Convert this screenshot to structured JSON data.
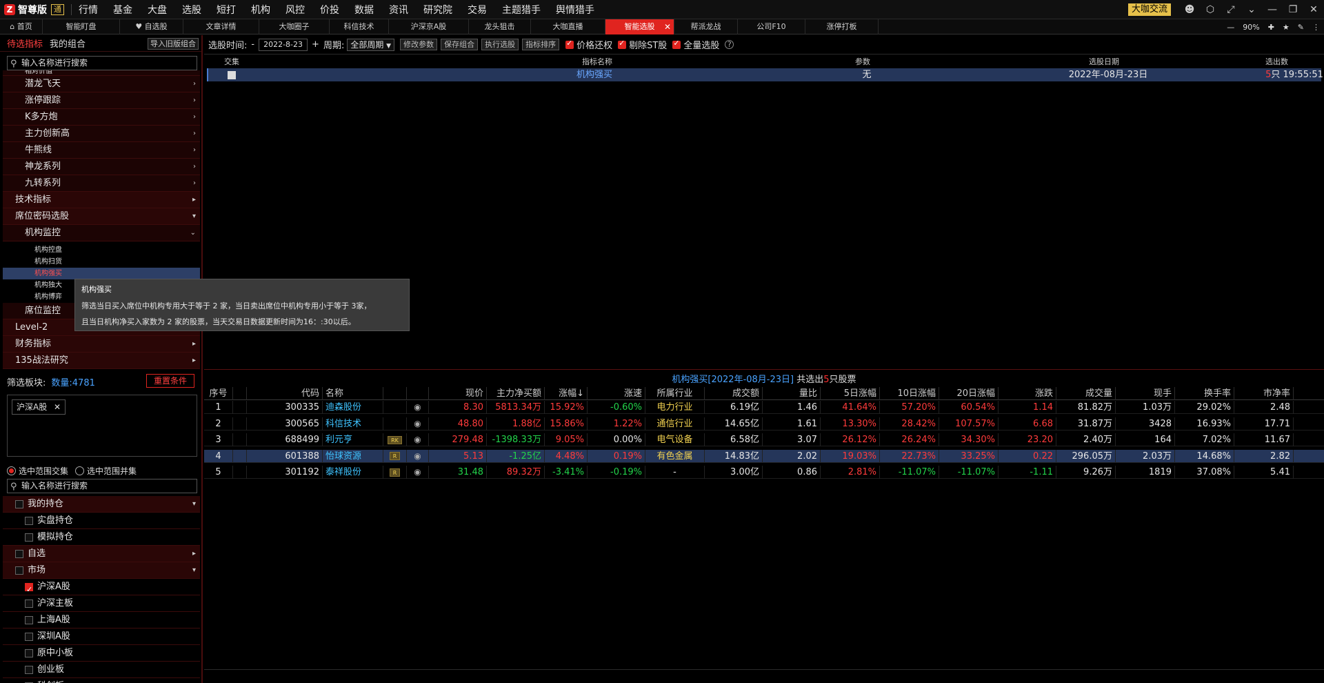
{
  "topbar": {
    "logo_mark": "Z",
    "brand": "智尊版",
    "edition_badge": "通",
    "menu": [
      {
        "label": "行情",
        "dot": false
      },
      {
        "label": "基金",
        "dot": false
      },
      {
        "label": "大盘",
        "dot": false
      },
      {
        "label": "选股",
        "dot": true
      },
      {
        "label": "短打",
        "dot": false
      },
      {
        "label": "机构",
        "dot": true
      },
      {
        "label": "风控",
        "dot": false
      },
      {
        "label": "价投",
        "dot": false
      },
      {
        "label": "数据",
        "dot": false
      },
      {
        "label": "资讯",
        "dot": false
      },
      {
        "label": "研究院",
        "dot": false
      },
      {
        "label": "交易",
        "dot": false
      },
      {
        "label": "主题猎手",
        "dot": false
      },
      {
        "label": "舆情猎手",
        "dot": true
      }
    ],
    "right_button": "大咖交流",
    "icons": [
      "user-icon",
      "settings-hex-icon",
      "collapse-icon",
      "chevron-down-icon",
      "minimize-icon",
      "restore-icon",
      "close-icon"
    ]
  },
  "tabs": {
    "items": [
      {
        "label": "首页",
        "icon": "home-icon",
        "active": false
      },
      {
        "label": "智能盯盘",
        "active": false
      },
      {
        "label": "自选股",
        "icon": "heart-icon",
        "active": false
      },
      {
        "label": "文章详情",
        "active": false
      },
      {
        "label": "大咖圈子",
        "active": false
      },
      {
        "label": "科信技术",
        "active": false
      },
      {
        "label": "沪深京A股",
        "active": false
      },
      {
        "label": "龙头狙击",
        "active": false
      },
      {
        "label": "大咖直播",
        "active": false
      },
      {
        "label": "智能选股",
        "active": true
      },
      {
        "label": "帮派龙战",
        "active": false
      },
      {
        "label": "公司F10",
        "active": false
      },
      {
        "label": "涨停打板",
        "active": false
      }
    ],
    "zoom": "90%"
  },
  "left": {
    "tabs": [
      "待选指标",
      "我的组合"
    ],
    "import_button": "导入旧版组合",
    "search_placeholder": "输入名称进行搜索",
    "partial_top": "相对价值",
    "tree": [
      {
        "label": "潜龙飞天",
        "level": 2,
        "arrow": "›"
      },
      {
        "label": "涨停跟踪",
        "level": 2,
        "arrow": "›"
      },
      {
        "label": "K多方炮",
        "level": 2,
        "arrow": "›"
      },
      {
        "label": "主力创新高",
        "level": 2,
        "arrow": "›"
      },
      {
        "label": "牛熊线",
        "level": 2,
        "arrow": "›"
      },
      {
        "label": "神龙系列",
        "level": 2,
        "arrow": "›"
      },
      {
        "label": "九转系列",
        "level": 2,
        "arrow": "›"
      },
      {
        "label": "技术指标",
        "level": 1,
        "arrow": "▸"
      },
      {
        "label": "席位密码选股",
        "level": 1,
        "arrow": "▾"
      },
      {
        "label": "机构监控",
        "level": 2,
        "arrow": "⌄"
      }
    ],
    "leaves": [
      "机构控盘",
      "机构扫货",
      "机构强买",
      "机构独大",
      "机构博弈"
    ],
    "selected_leaf": 2,
    "tree_after": [
      {
        "label": "席位监控",
        "level": 2,
        "arrow": ""
      },
      {
        "label": "Level-2",
        "level": 1,
        "arrow": ""
      },
      {
        "label": "财务指标",
        "level": 1,
        "arrow": "▸"
      },
      {
        "label": "135战法研究",
        "level": 1,
        "arrow": "▸"
      }
    ],
    "filter_label": "筛选板块:",
    "filter_count": "数量:4781",
    "reset_button": "重置条件",
    "chip": "沪深A股",
    "radio_intersect": "选中范围交集",
    "radio_union": "选中范围并集",
    "search2_placeholder": "输入名称进行搜索",
    "market_tree": [
      {
        "label": "我的持仓",
        "level": 1,
        "checked": false,
        "arrow": "▾"
      },
      {
        "label": "实盘持仓",
        "level": 2,
        "checked": false,
        "arrow": ""
      },
      {
        "label": "模拟持仓",
        "level": 2,
        "checked": false,
        "arrow": ""
      },
      {
        "label": "自选",
        "level": 1,
        "checked": false,
        "arrow": "▸"
      },
      {
        "label": "市场",
        "level": 1,
        "checked": false,
        "arrow": "▾"
      },
      {
        "label": "沪深A股",
        "level": 2,
        "checked": true,
        "arrow": ""
      },
      {
        "label": "沪深主板",
        "level": 2,
        "checked": false,
        "arrow": ""
      },
      {
        "label": "上海A股",
        "level": 2,
        "checked": false,
        "arrow": ""
      },
      {
        "label": "深圳A股",
        "level": 2,
        "checked": false,
        "arrow": ""
      },
      {
        "label": "原中小板",
        "level": 2,
        "checked": false,
        "arrow": ""
      },
      {
        "label": "创业板",
        "level": 2,
        "checked": false,
        "arrow": ""
      },
      {
        "label": "科创板",
        "level": 2,
        "checked": false,
        "arrow": ""
      }
    ]
  },
  "toolbar": {
    "time_label": "选股时间:",
    "dash": "-",
    "date": "2022-8-23",
    "plus": "+",
    "period_label": "周期:",
    "period_value": "全部周期",
    "buttons": [
      "修改参数",
      "保存组合",
      "执行选股",
      "指标排序"
    ],
    "checks": [
      "价格还权",
      "剔除ST股",
      "全量选股"
    ],
    "help": "?"
  },
  "upper": {
    "headers": [
      "交集",
      "指标名称",
      "参数",
      "选股日期",
      "选出数"
    ],
    "row": {
      "name": "机构强买",
      "param": "无",
      "date": "2022年-08月-23日",
      "count": "5",
      "count_suffix": "只 19:55:51"
    }
  },
  "result_title": {
    "prefix": "机构强买[2022年-08月-23日]",
    "middle": " 共选出",
    "count": "5",
    "suffix": "只股票"
  },
  "lower": {
    "headers": [
      "序号",
      "代码",
      "名称",
      "现价",
      "主力净买额",
      "涨幅↓",
      "涨速",
      "所属行业",
      "成交额",
      "量比",
      "5日涨幅",
      "10日涨幅",
      "20日涨幅",
      "涨跌",
      "成交量",
      "现手",
      "换手率",
      "市净率"
    ],
    "rows": [
      {
        "no": "1",
        "code": "300335",
        "name": "迪森股份",
        "tag": "",
        "price": "8.30",
        "net": "5813.34万",
        "chg": "15.92%",
        "speed": "-0.60%",
        "industry": "电力行业",
        "amount": "6.19亿",
        "vr": "1.46",
        "d5": "41.64%",
        "d10": "57.20%",
        "d20": "60.54%",
        "up": "1.14",
        "vol": "81.82万",
        "hand": "1.03万",
        "turn": "29.02%",
        "pb": "2.48",
        "c": {
          "price": "red",
          "net": "red",
          "chg": "red",
          "speed": "green",
          "d5": "red",
          "d10": "red",
          "d20": "red",
          "up": "red"
        }
      },
      {
        "no": "2",
        "code": "300565",
        "name": "科信技术",
        "tag": "",
        "price": "48.80",
        "net": "1.88亿",
        "chg": "15.86%",
        "speed": "1.22%",
        "industry": "通信行业",
        "amount": "14.65亿",
        "vr": "1.61",
        "d5": "13.30%",
        "d10": "28.42%",
        "d20": "107.57%",
        "up": "6.68",
        "vol": "31.87万",
        "hand": "3428",
        "turn": "16.93%",
        "pb": "17.71",
        "c": {
          "price": "red",
          "net": "red",
          "chg": "red",
          "speed": "red",
          "d5": "red",
          "d10": "red",
          "d20": "red",
          "up": "red"
        }
      },
      {
        "no": "3",
        "code": "688499",
        "name": "利元亨",
        "tag": "RK",
        "price": "279.48",
        "net": "-1398.33万",
        "chg": "9.05%",
        "speed": "0.00%",
        "industry": "电气设备",
        "amount": "6.58亿",
        "vr": "3.07",
        "d5": "26.12%",
        "d10": "26.24%",
        "d20": "34.30%",
        "up": "23.20",
        "vol": "2.40万",
        "hand": "164",
        "turn": "7.02%",
        "pb": "11.67",
        "c": {
          "price": "red",
          "net": "green",
          "chg": "red",
          "speed": "white",
          "d5": "red",
          "d10": "red",
          "d20": "red",
          "up": "red"
        }
      },
      {
        "no": "4",
        "code": "601388",
        "name": "怡球资源",
        "tag": "R",
        "price": "5.13",
        "net": "-1.25亿",
        "chg": "4.48%",
        "speed": "0.19%",
        "industry": "有色金属",
        "amount": "14.83亿",
        "vr": "2.02",
        "d5": "19.03%",
        "d10": "22.73%",
        "d20": "33.25%",
        "up": "0.22",
        "vol": "296.05万",
        "hand": "2.03万",
        "turn": "14.68%",
        "pb": "2.82",
        "c": {
          "price": "red",
          "net": "green",
          "chg": "red",
          "speed": "red",
          "d5": "red",
          "d10": "red",
          "d20": "red",
          "up": "red"
        }
      },
      {
        "no": "5",
        "code": "301192",
        "name": "泰祥股份",
        "tag": "R",
        "price": "31.48",
        "net": "89.32万",
        "chg": "-3.41%",
        "speed": "-0.19%",
        "industry": "-",
        "amount": "3.00亿",
        "vr": "0.86",
        "d5": "2.81%",
        "d10": "-11.07%",
        "d20": "-11.07%",
        "up": "-1.11",
        "vol": "9.26万",
        "hand": "1819",
        "turn": "37.08%",
        "pb": "5.41",
        "c": {
          "price": "green",
          "net": "red",
          "chg": "green",
          "speed": "green",
          "d5": "red",
          "d10": "green",
          "d20": "green",
          "up": "green"
        }
      }
    ],
    "selected_row": 3
  },
  "tooltip": {
    "title": "机构强买",
    "line1": "筛选当日买入席位中机构专用大于等于 2 家，当日卖出席位中机构专用小于等于 3家，",
    "line2": "且当日机构净买入家数为 2 家的股票，当天交易日数据更新时间为16：:30以后。"
  },
  "colors": {
    "accent": "#e0241f",
    "selection": "#25365a",
    "up": "#ff3b3b",
    "down": "#22d34a",
    "link": "#3fc3ff"
  }
}
